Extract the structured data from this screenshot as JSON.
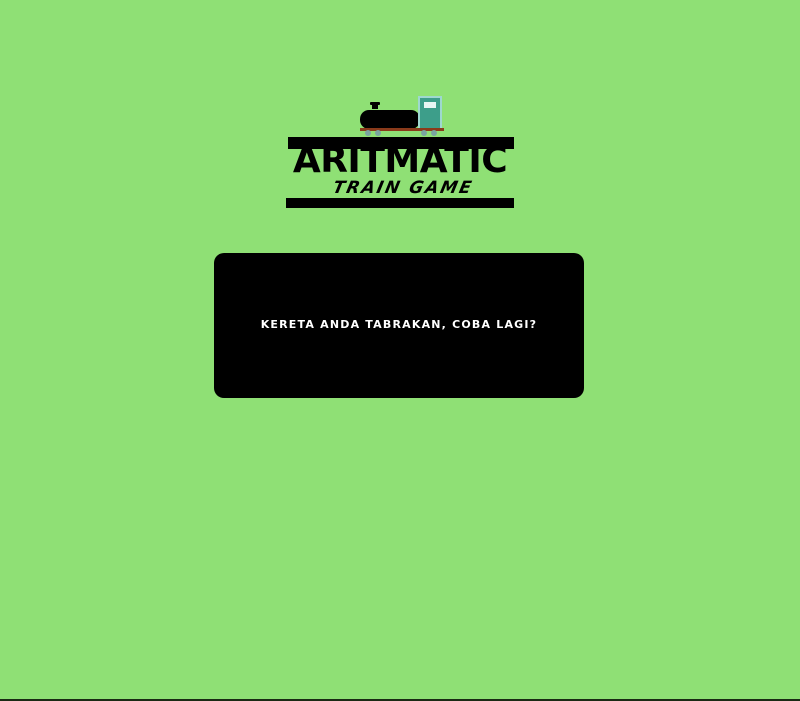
{
  "logo": {
    "title": "ARITMATIC",
    "subtitle": "TRAIN GAME"
  },
  "message": {
    "text": "KERETA ANDA TABRAKAN, COBA LAGI?"
  },
  "colors": {
    "background": "#8fe075",
    "panel": "#000000",
    "panel_text": "#ffffff",
    "train_cab": "#3d9e8a",
    "train_body": "#000000",
    "rail": "#8a3a1a"
  },
  "icons": {
    "logo_icon": "train-icon"
  }
}
